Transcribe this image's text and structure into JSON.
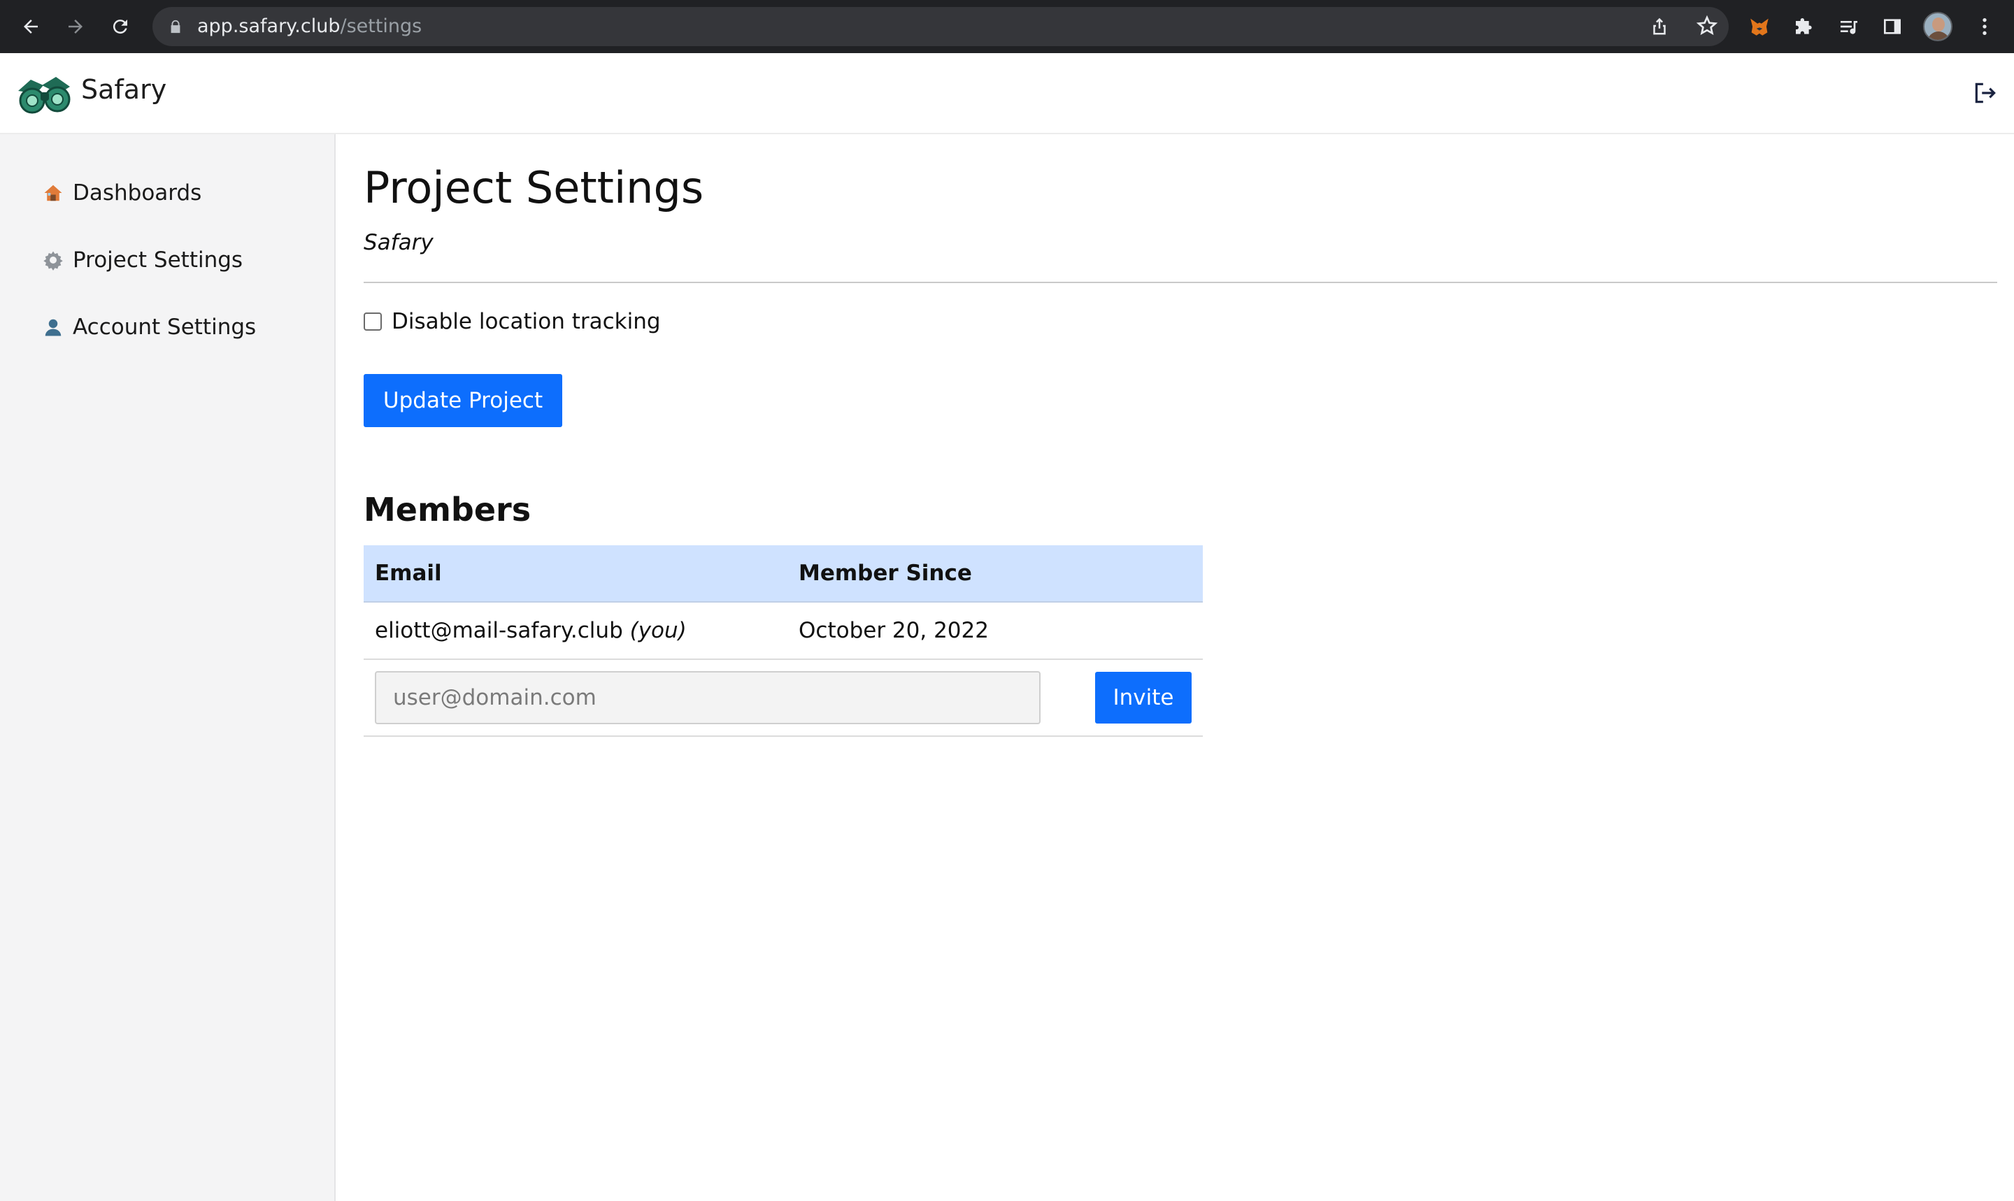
{
  "browser": {
    "url_host": "app.safary.club",
    "url_path": "/settings"
  },
  "header": {
    "brand": "Safary"
  },
  "sidebar": {
    "items": [
      {
        "label": "Dashboards",
        "icon": "house-icon"
      },
      {
        "label": "Project Settings",
        "icon": "gear-icon"
      },
      {
        "label": "Account Settings",
        "icon": "user-icon"
      }
    ]
  },
  "main": {
    "title": "Project Settings",
    "project_name": "Safary",
    "disable_location_label": "Disable location tracking",
    "disable_location_checked": false,
    "update_button": "Update Project",
    "members_title": "Members",
    "table": {
      "columns": [
        "Email",
        "Member Since"
      ],
      "rows": [
        {
          "email": "eliott@mail-safary.club",
          "you_tag": "(you)",
          "since": "October 20, 2022"
        }
      ]
    },
    "invite": {
      "placeholder": "user@domain.com",
      "button": "Invite"
    }
  },
  "colors": {
    "primary": "#0d6efd",
    "table_header": "#cfe2ff",
    "sidebar_bg": "#f4f4f5",
    "chrome_bg": "#202124"
  }
}
